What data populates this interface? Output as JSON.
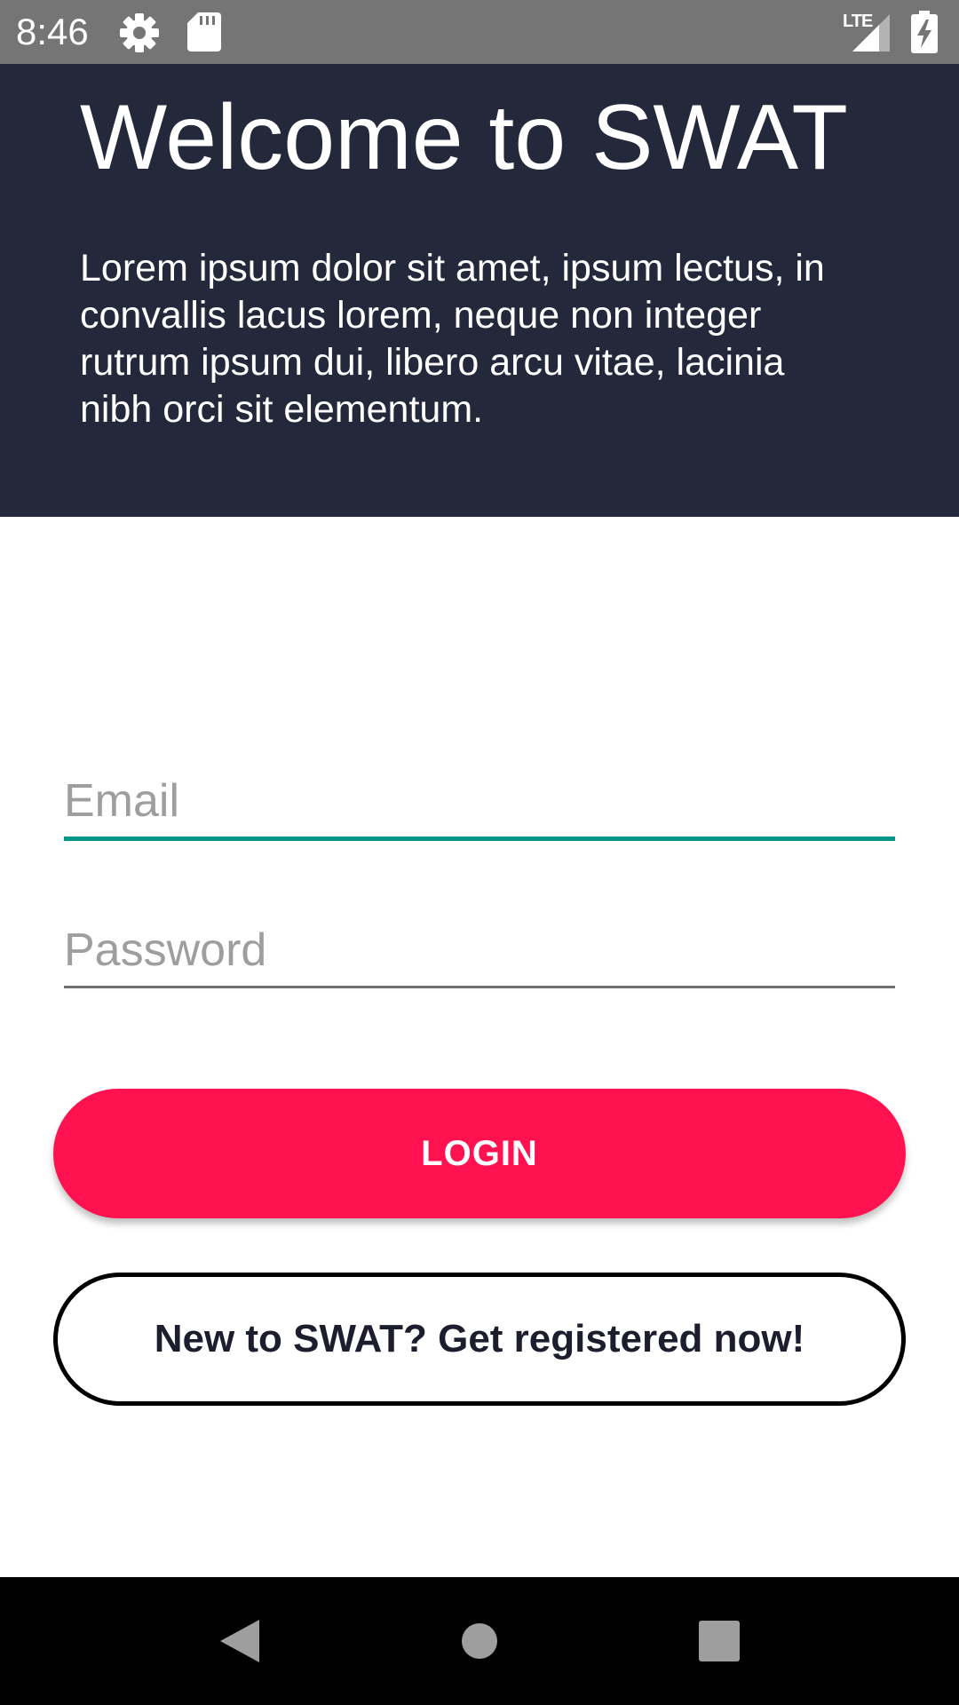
{
  "status_bar": {
    "time": "8:46",
    "icons": [
      "gear-icon",
      "sd-card-icon",
      "lte-signal-icon",
      "battery-charging-icon"
    ],
    "network_label": "LTE"
  },
  "header": {
    "title": "Welcome to SWAT",
    "description": "Lorem ipsum dolor sit amet, ipsum lectus, in convallis lacus lorem, neque non integer rutrum ipsum dui, libero arcu vitae, lacinia nibh orci sit elementum."
  },
  "form": {
    "email": {
      "value": "",
      "placeholder": "Email"
    },
    "password": {
      "value": "",
      "placeholder": "Password"
    }
  },
  "buttons": {
    "login_label": "LOGIN",
    "register_label": "New to SWAT? Get registered now!"
  },
  "nav_bar": {
    "icons": [
      "back-icon",
      "home-icon",
      "recents-icon"
    ]
  },
  "colors": {
    "header_bg": "#24283b",
    "status_bar_bg": "#757575",
    "accent": "#00968a",
    "login_button": "#ff124f",
    "register_text": "#1c1e2e",
    "nav_bar_bg": "#000000"
  }
}
